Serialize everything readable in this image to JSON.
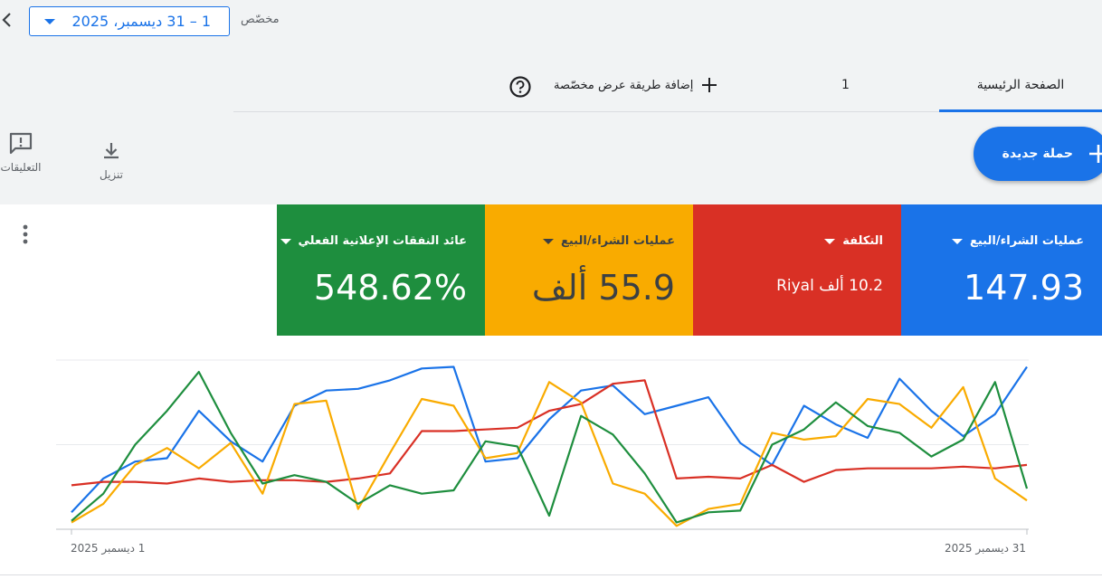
{
  "header": {
    "date_range": "1 – 31 ديسمبر، 2025",
    "custom_label": "مخصّص"
  },
  "tabs": [
    {
      "label": "الصفحة الرئيسية",
      "active": true
    },
    {
      "label": "1"
    },
    {
      "label": "إضافة طريقة عرض مخصّصة"
    }
  ],
  "toolbar": {
    "new_campaign": "حملة جديدة",
    "download": "تنزيل",
    "feedback": "التعليقات"
  },
  "metrics": [
    {
      "title": "عمليات الشراء/البيع",
      "value": "147.93",
      "color": "#1a73e8"
    },
    {
      "title": "التكلفة",
      "value": "10.2 ألف Riyal",
      "color": "#d93025"
    },
    {
      "title": "عمليات الشراء/البيع",
      "value": "55.9 ألف",
      "color": "#f9ab00"
    },
    {
      "title": "عائد النفقات الإعلانية الفعلي",
      "value": "548.62%",
      "color": "#1e8e3e"
    }
  ],
  "chart_data": {
    "type": "line",
    "x_start_label": "1 ديسمبر 2025",
    "x_end_label": "31 ديسمبر 2025",
    "x_direction": "right-to-left",
    "ylim": [
      0,
      100
    ],
    "grid": true,
    "series": [
      {
        "color": "#1a73e8",
        "values": [
          10,
          30,
          40,
          42,
          70,
          52,
          40,
          73,
          82,
          83,
          88,
          95,
          96,
          40,
          42,
          65,
          82,
          85,
          68,
          73,
          78,
          51,
          38,
          73,
          62,
          54,
          89,
          70,
          55,
          68,
          96
        ]
      },
      {
        "color": "#d93025",
        "values": [
          26,
          28,
          28,
          27,
          30,
          28,
          29,
          29,
          28,
          30,
          33,
          58,
          58,
          59,
          60,
          70,
          74,
          86,
          88,
          30,
          31,
          30,
          38,
          28,
          35,
          36,
          36,
          36,
          37,
          36,
          38
        ]
      },
      {
        "color": "#f9ab00",
        "values": [
          4,
          15,
          38,
          48,
          36,
          51,
          21,
          74,
          76,
          12,
          45,
          77,
          73,
          42,
          45,
          87,
          75,
          27,
          21,
          2,
          12,
          15,
          57,
          53,
          55,
          77,
          74,
          60,
          84,
          30,
          17
        ]
      },
      {
        "color": "#1e8e3e",
        "values": [
          5,
          21,
          50,
          70,
          93,
          57,
          27,
          32,
          28,
          15,
          26,
          21,
          23,
          52,
          49,
          8,
          67,
          56,
          33,
          4,
          10,
          11,
          50,
          59,
          75,
          61,
          57,
          43,
          53,
          87,
          24
        ]
      }
    ]
  }
}
